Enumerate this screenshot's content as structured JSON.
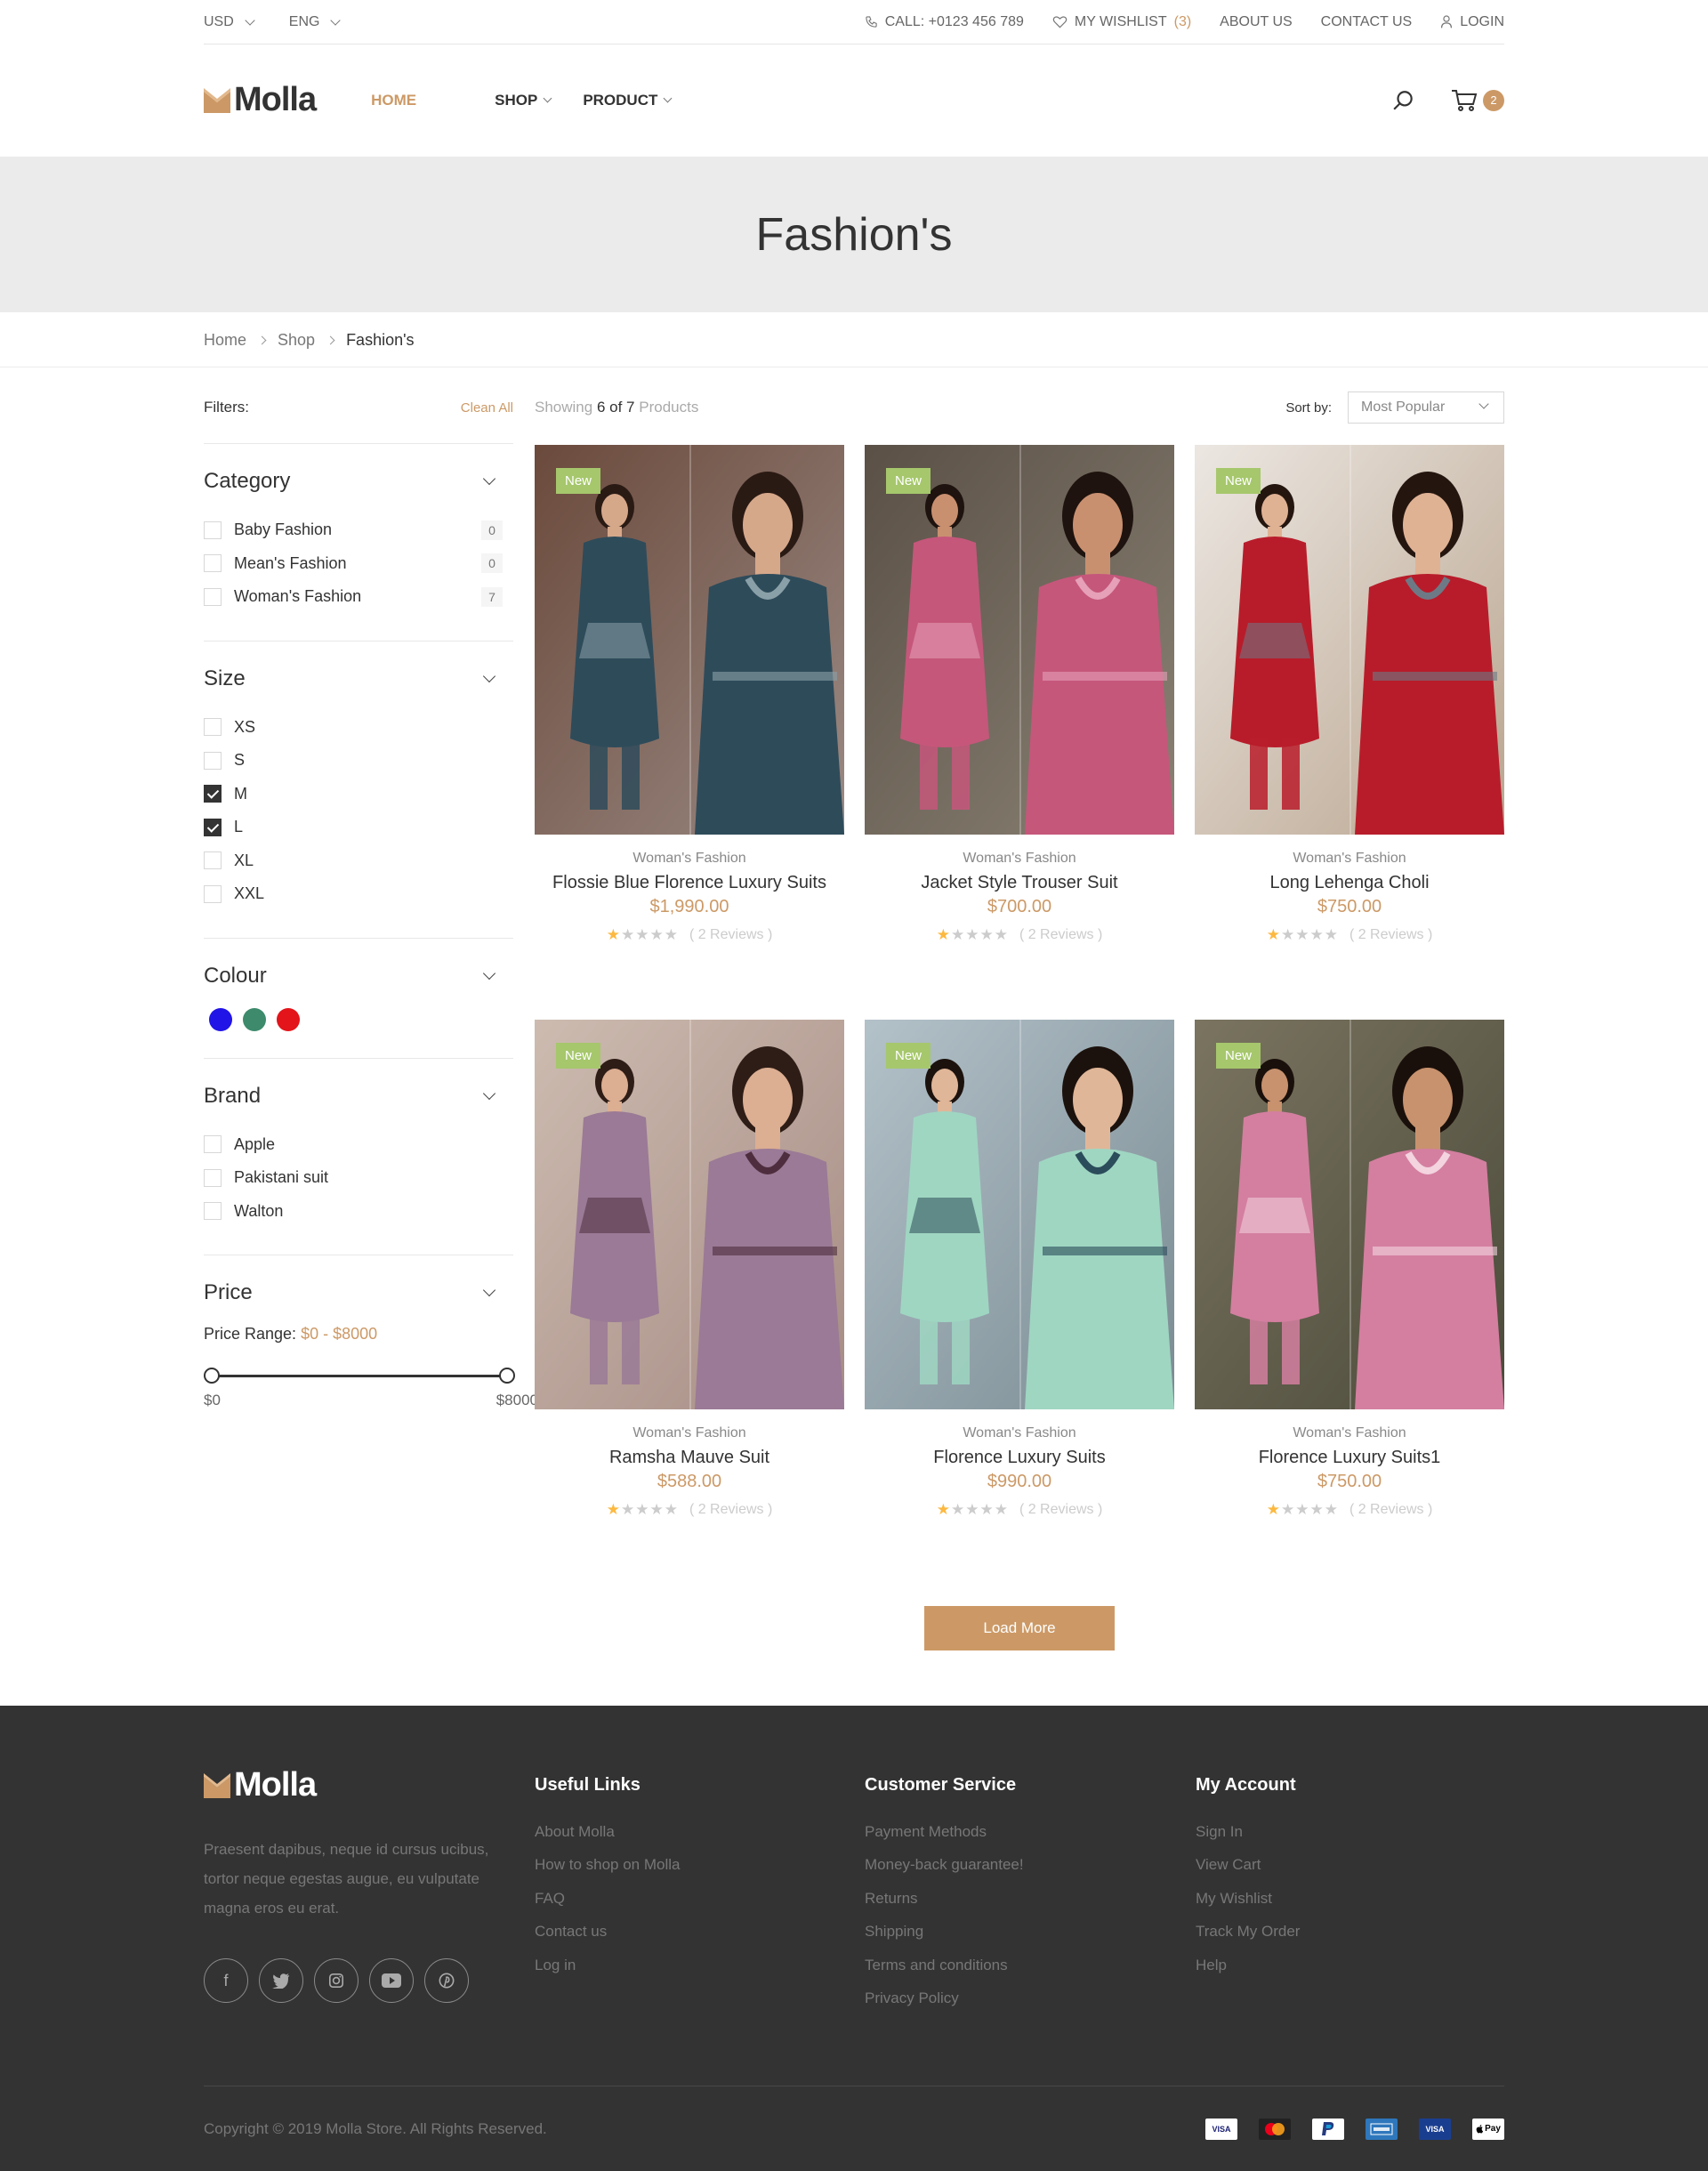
{
  "topbar": {
    "currency": "USD",
    "language": "ENG",
    "call": "CALL: +0123 456 789",
    "wishlist_label": "MY WISHLIST",
    "wishlist_count": "(3)",
    "about": "ABOUT US",
    "contact": "CONTACT US",
    "login": "LOGIN"
  },
  "header": {
    "logo": "Molla",
    "nav": {
      "home": "HOME",
      "shop": "SHOP",
      "product": "PRODUCT"
    },
    "cart_count": "2"
  },
  "page_title": "Fashion's",
  "breadcrumb": [
    "Home",
    "Shop",
    "Fashion's"
  ],
  "filters": {
    "label": "Filters:",
    "clean_all": "Clean All",
    "category": {
      "title": "Category",
      "items": [
        {
          "label": "Baby Fashion",
          "count": "0"
        },
        {
          "label": "Mean's Fashion",
          "count": "0"
        },
        {
          "label": "Woman's Fashion",
          "count": "7"
        }
      ]
    },
    "size": {
      "title": "Size",
      "items": [
        {
          "label": "XS",
          "checked": false
        },
        {
          "label": "S",
          "checked": false
        },
        {
          "label": "M",
          "checked": true
        },
        {
          "label": "L",
          "checked": true
        },
        {
          "label": "XL",
          "checked": false
        },
        {
          "label": "XXL",
          "checked": false
        }
      ]
    },
    "colour": {
      "title": "Colour",
      "swatches": [
        "#2114e6",
        "#3d8a6c",
        "#e3141a"
      ]
    },
    "brand": {
      "title": "Brand",
      "items": [
        "Apple",
        "Pakistani suit",
        "Walton"
      ]
    },
    "price": {
      "title": "Price",
      "range_label": "Price Range:",
      "range_value": "$0 - $8000",
      "min_label": "$0",
      "max_label": "$8000"
    }
  },
  "toolbox": {
    "showing_prefix": "Showing",
    "showing_count": "6 of 7",
    "showing_suffix": "Products",
    "sort_label": "Sort by:",
    "sort_value": "Most Popular"
  },
  "products": [
    {
      "badge": "New",
      "category": "Woman's Fashion",
      "name": "Flossie Blue Florence Luxury Suits",
      "price": "$1,990.00",
      "reviews": "( 2 Reviews )",
      "rating": 1
    },
    {
      "badge": "New",
      "category": "Woman's Fashion",
      "name": "Jacket Style Trouser Suit",
      "price": "$700.00",
      "reviews": "( 2 Reviews )",
      "rating": 1
    },
    {
      "badge": "New",
      "category": "Woman's Fashion",
      "name": "Long Lehenga Choli",
      "price": "$750.00",
      "reviews": "( 2 Reviews )",
      "rating": 1
    },
    {
      "badge": "New",
      "category": "Woman's Fashion",
      "name": "Ramsha Mauve Suit",
      "price": "$588.00",
      "reviews": "( 2 Reviews )",
      "rating": 1
    },
    {
      "badge": "New",
      "category": "Woman's Fashion",
      "name": "Florence Luxury Suits",
      "price": "$990.00",
      "reviews": "( 2 Reviews )",
      "rating": 1
    },
    {
      "badge": "New",
      "category": "Woman's Fashion",
      "name": "Florence Luxury Suits1",
      "price": "$750.00",
      "reviews": "( 2 Reviews )",
      "rating": 1
    }
  ],
  "load_more": "Load More",
  "footer": {
    "logo": "Molla",
    "about": "Praesent dapibus, neque id cursus ucibus, tortor neque egestas augue, eu vulputate magna eros eu erat.",
    "socials": [
      "facebook-icon",
      "twitter-icon",
      "instagram-icon",
      "youtube-icon",
      "pinterest-icon"
    ],
    "useful_links": {
      "title": "Useful Links",
      "items": [
        "About Molla",
        "How to shop on Molla",
        "FAQ",
        "Contact us",
        "Log in"
      ]
    },
    "customer_service": {
      "title": "Customer Service",
      "items": [
        "Payment Methods",
        "Money-back guarantee!",
        "Returns",
        "Shipping",
        "Terms and conditions",
        "Privacy Policy"
      ]
    },
    "my_account": {
      "title": "My Account",
      "items": [
        "Sign In",
        "View Cart",
        "My Wishlist",
        "Track My Order",
        "Help"
      ]
    },
    "copyright": "Copyright © 2019 Molla Store. All Rights Reserved.",
    "payments": [
      "visa-icon",
      "mastercard-icon",
      "paypal-icon",
      "amex-icon",
      "visa-electron-icon",
      "apple-pay-icon"
    ]
  },
  "colors": {
    "accent": "#cc9966",
    "badge_new": "#a6c76c",
    "footer_bg": "#333333"
  }
}
